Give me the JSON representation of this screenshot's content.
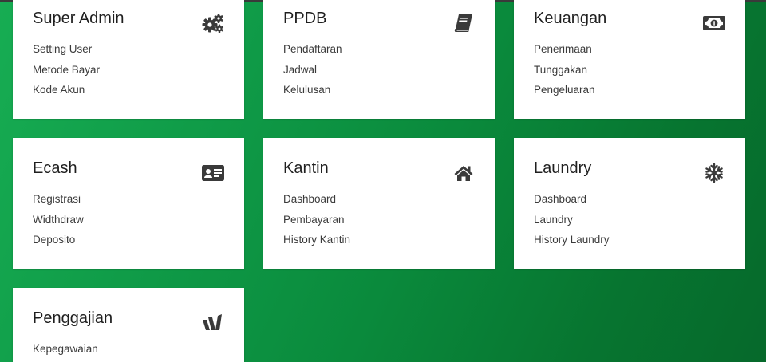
{
  "cards": [
    {
      "title": "Super Admin",
      "icon": "gears-icon",
      "items": [
        "Setting User",
        "Metode Bayar",
        "Kode Akun"
      ]
    },
    {
      "title": "PPDB",
      "icon": "book-icon",
      "items": [
        "Pendaftaran",
        "Jadwal",
        "Kelulusan"
      ]
    },
    {
      "title": "Keuangan",
      "icon": "money-bill-icon",
      "items": [
        "Penerimaan",
        "Tunggakan",
        "Pengeluaran"
      ]
    },
    {
      "title": "Ecash",
      "icon": "id-card-icon",
      "items": [
        "Registrasi",
        "Widthdraw",
        "Deposito"
      ]
    },
    {
      "title": "Kantin",
      "icon": "home-icon",
      "items": [
        "Dashboard",
        "Pembayaran",
        "History Kantin"
      ]
    },
    {
      "title": "Laundry",
      "icon": "snowflake-icon",
      "items": [
        "Dashboard",
        "Laundry",
        "History Laundry"
      ]
    },
    {
      "title": "Penggajian",
      "icon": "w-logo-icon",
      "items": [
        "Kepegawaian"
      ]
    }
  ],
  "colors": {
    "bg_light": "#17ad53",
    "bg_dark": "#06692b",
    "card": "#ffffff",
    "icon": "#3a3a3a"
  }
}
